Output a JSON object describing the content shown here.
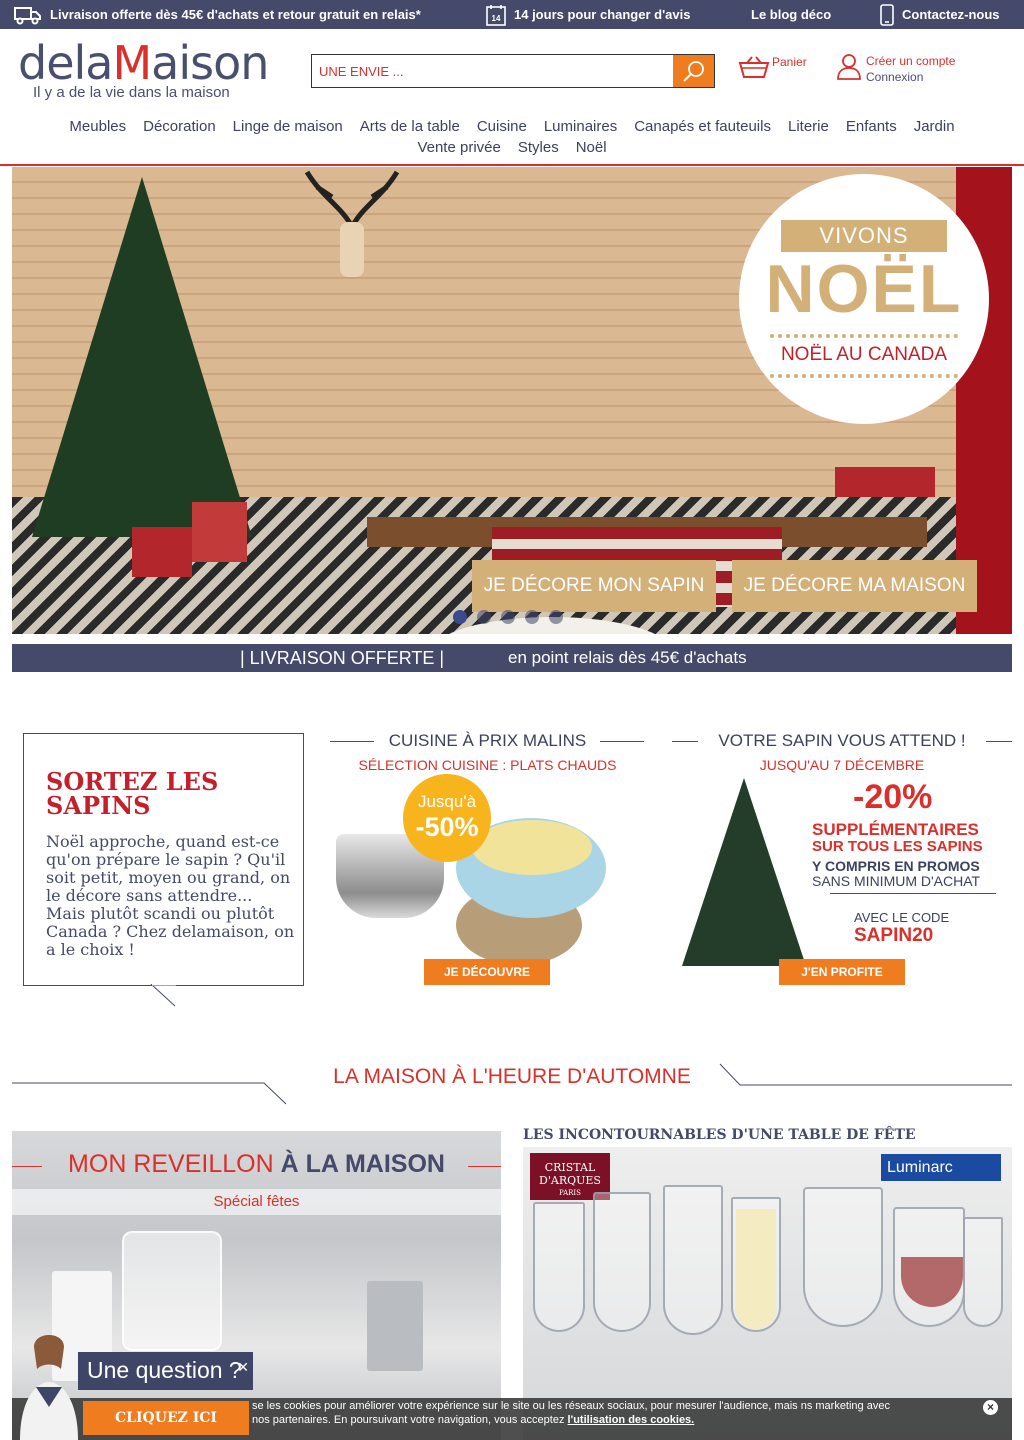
{
  "topbar": {
    "shipping": "Livraison offerte dès 45€  d'achats et retour gratuit en relais*",
    "days_icon": "14",
    "returns": "14 jours pour changer d'avis",
    "blog": "Le blog déco",
    "contact": "Contactez-nous"
  },
  "logo": {
    "part1": "dela",
    "part2": "M",
    "part3": "aison",
    "tagline": "Il y a de la vie dans la maison"
  },
  "search": {
    "placeholder": "UNE ENVIE ..."
  },
  "header": {
    "cart": "Panier",
    "create_account": "Créer un compte",
    "login": "Connexion"
  },
  "nav": {
    "row1": [
      "Meubles",
      "Décoration",
      "Linge de maison",
      "Arts de la table",
      "Cuisine",
      "Luminaires",
      "Canapés et fauteuils",
      "Literie",
      "Enfants",
      "Jardin"
    ],
    "row2": [
      "Vente privée",
      "Styles",
      "Noël"
    ]
  },
  "hero": {
    "badge_top": "VIVONS",
    "badge_main": "NOËL",
    "badge_sub": "NOËL AU CANADA",
    "btn_tree": "JE DÉCORE MON SAPIN",
    "btn_home": "JE DÉCORE MA MAISON",
    "slide_count": 5,
    "active_slide": 1
  },
  "strip": {
    "main": "|   LIVRAISON OFFERTE   |",
    "detail": "en point relais dès 45€ d'achats"
  },
  "sapins": {
    "title": "SORTEZ LES SAPINS",
    "text": "Noël approche, quand est-ce qu'on prépare le sapin ? Qu'il soit petit, moyen ou grand, on le décore sans attendre... Mais plutôt scandi ou plutôt Canada ? Chez delamaison, on a le choix !"
  },
  "cuisine": {
    "title": "CUISINE À PRIX MALINS",
    "subtitle": "SÉLECTION CUISINE : PLATS CHAUDS",
    "badge_top": "Jusqu'à",
    "badge_value": "-50%",
    "button": "JE DÉCOUVRE"
  },
  "sapin_promo": {
    "title": "VOTRE SAPIN VOUS ATTEND !",
    "subtitle": "JUSQU'AU 7 DÉCEMBRE",
    "discount": "-20%",
    "line1": "SUPPLÉMENTAIRES",
    "line2": "SUR TOUS LES SAPINS",
    "line3": "Y COMPRIS EN PROMOS",
    "line4": "SANS MINIMUM D'ACHAT",
    "code_label": "AVEC LE CODE",
    "code": "SAPIN20",
    "button": "J'EN PROFITE"
  },
  "section": {
    "title": "LA MAISON À L'HEURE D'AUTOMNE"
  },
  "card1": {
    "title_a": "MON REVEILLON ",
    "title_b": "À LA MAISON",
    "subtitle": "Spécial fêtes"
  },
  "card2": {
    "title": "LES INCONTOURNABLES D'UNE TABLE DE FÊTE",
    "brand1_line1": "CRISTAL",
    "brand1_line2": "D'ARQUES",
    "brand1_line3": "PARIS",
    "brand2": "Luminarc"
  },
  "chat": {
    "question": "Une question ?",
    "button": "CLIQUEZ ICI"
  },
  "cookie": {
    "text": "se les cookies pour améliorer votre expérience sur le site ou les réseaux sociaux, pour mesurer l'audience, mais ns marketing avec nos partenaires. En poursuivant votre navigation, vous acceptez ",
    "link": "l'utilisation des cookies.",
    "close": "×"
  },
  "colors": {
    "brand_navy": "#45496a",
    "brand_red": "#d9302b",
    "accent_orange": "#f07c20",
    "gold": "#d4b079"
  }
}
